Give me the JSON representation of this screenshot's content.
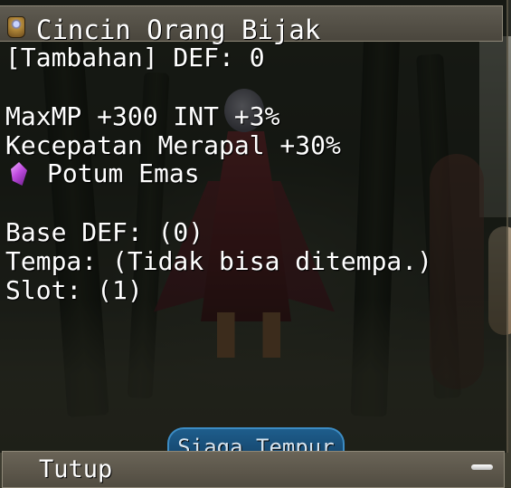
{
  "tooltip": {
    "title": "Cincin Orang Bijak",
    "bonus_line": "[Tambahan] DEF: 0",
    "stats_line_1": "MaxMP +300 INT +3%",
    "stats_line_2": "Kecepatan Merapal +30%",
    "gem_label": "Potum Emas",
    "base_def": "Base DEF: (0)",
    "refine": "Tempa: (Tidak bisa ditempa.)",
    "slot": "Slot: (1)",
    "icons": {
      "item": "ring-icon",
      "gem": "purple-gem-icon"
    }
  },
  "bottom_bar": {
    "close_label": "Tutup",
    "action_button_label": "Siaga Tempur",
    "minimize_icon": "minimize-icon"
  }
}
